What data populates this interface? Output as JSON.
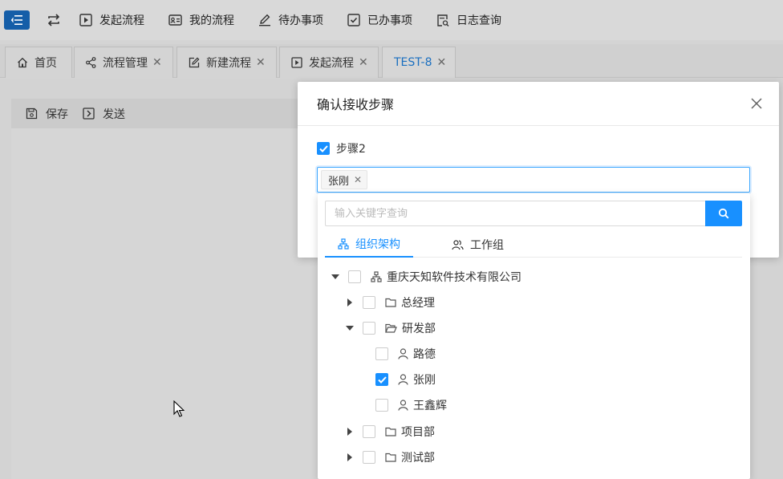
{
  "topnav": {
    "items": [
      {
        "label": "发起流程",
        "icon": "play-square-icon"
      },
      {
        "label": "我的流程",
        "icon": "id-card-icon"
      },
      {
        "label": "待办事项",
        "icon": "edit-pen-icon"
      },
      {
        "label": "已办事项",
        "icon": "check-square-icon"
      },
      {
        "label": "日志查询",
        "icon": "file-search-icon"
      }
    ]
  },
  "tabs": [
    {
      "label": "首页",
      "icon": "home-icon"
    },
    {
      "label": "流程管理",
      "icon": "share-icon"
    },
    {
      "label": "新建流程",
      "icon": "edit-square-icon"
    },
    {
      "label": "发起流程",
      "icon": "play-square-icon"
    },
    {
      "label": "TEST-8",
      "icon": ""
    }
  ],
  "toolbar": {
    "save_label": "保存",
    "send_label": "发送"
  },
  "modal": {
    "title": "确认接收步骤",
    "step_label": "步骤2",
    "selected_tag": "张刚"
  },
  "dropdown": {
    "search_placeholder": "输入关键字查询",
    "tab_org": "组织架构",
    "tab_group": "工作组",
    "tree": {
      "root": "重庆天知软件技术有限公司",
      "dept1": "总经理",
      "dept2": "研发部",
      "user1": "路德",
      "user2": "张刚",
      "user3": "王鑫辉",
      "dept3": "项目部",
      "dept4": "测试部"
    }
  },
  "colors": {
    "accent": "#1890ff",
    "menu_button": "#155ea8"
  }
}
